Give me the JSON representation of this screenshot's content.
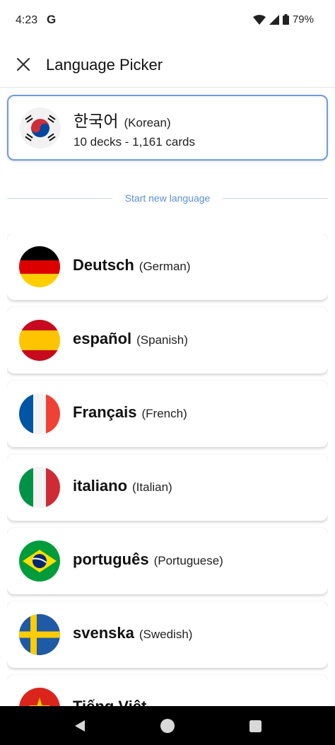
{
  "status_bar": {
    "time": "4:23",
    "g_label": "G",
    "battery": "79%"
  },
  "app_bar": {
    "title": "Language Picker",
    "close_icon": "close-icon"
  },
  "current_language": {
    "native": "한국어",
    "english": "(Korean)",
    "stats": "10 decks - 1,161 cards",
    "flag": "korea-flag-icon"
  },
  "divider": {
    "label": "Start new language"
  },
  "languages": [
    {
      "native": "Deutsch",
      "english": "(German)",
      "flag": "germany-flag-icon"
    },
    {
      "native": "español",
      "english": "(Spanish)",
      "flag": "spain-flag-icon"
    },
    {
      "native": "Français",
      "english": "(French)",
      "flag": "france-flag-icon"
    },
    {
      "native": "italiano",
      "english": "(Italian)",
      "flag": "italy-flag-icon"
    },
    {
      "native": "português",
      "english": "(Portuguese)",
      "flag": "brazil-flag-icon"
    },
    {
      "native": "svenska",
      "english": "(Swedish)",
      "flag": "sweden-flag-icon"
    },
    {
      "native": "Tiếng Việt",
      "english": "",
      "flag": "vietnam-flag-icon"
    }
  ],
  "nav_bar": {
    "back_icon": "back-triangle-icon",
    "home_icon": "home-circle-icon",
    "recents_icon": "recents-square-icon"
  },
  "colors": {
    "accent_border": "#6f9be0",
    "divider_text": "#5b8fd6"
  }
}
